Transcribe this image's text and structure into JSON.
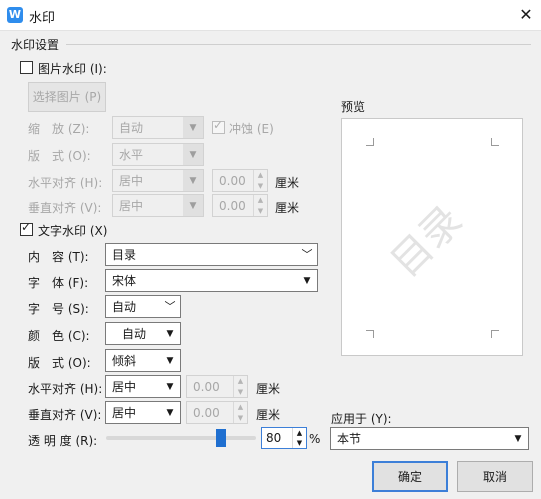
{
  "window": {
    "title": "水印",
    "app_icon": "W",
    "close": "✕"
  },
  "section_title": "水印设置",
  "picture_watermark": {
    "label": "图片水印 (I):",
    "checked": false,
    "select_button": "选择图片 (P)",
    "scale_label": "缩　放 (Z):",
    "scale_value": "自动",
    "washout_label": "冲蚀 (E)",
    "washout_checked": true,
    "layout_label": "版　式 (O):",
    "layout_value": "水平",
    "h_align_label": "水平对齐 (H):",
    "h_align_value": "居中",
    "h_offset_value": "0.00",
    "h_unit": "厘米",
    "v_align_label": "垂直对齐 (V):",
    "v_align_value": "居中",
    "v_offset_value": "0.00",
    "v_unit": "厘米"
  },
  "text_watermark": {
    "label": "文字水印 (X)",
    "checked": true,
    "content_label": "内　容 (T):",
    "content_value": "目录",
    "font_label": "字　体 (F):",
    "font_value": "宋体",
    "size_label": "字　号 (S):",
    "size_value": "自动",
    "color_label": "颜　色 (C):",
    "color_value": "自动",
    "layout_label": "版　式 (O):",
    "layout_value": "倾斜",
    "h_align_label": "水平对齐 (H):",
    "h_align_value": "居中",
    "h_offset_value": "0.00",
    "h_unit": "厘米",
    "v_align_label": "垂直对齐 (V):",
    "v_align_value": "居中",
    "v_offset_value": "0.00",
    "v_unit": "厘米",
    "transparency_label": "透 明 度 (R):",
    "transparency_value": "80",
    "transparency_unit": "%",
    "transparency_fraction": 0.8
  },
  "preview": {
    "label": "预览",
    "watermark_text": "目录"
  },
  "apply_to": {
    "label": "应用于 (Y):",
    "value": "本节"
  },
  "buttons": {
    "ok": "确定",
    "cancel": "取消"
  },
  "colors": {
    "accent": "#1f6fd0",
    "icon": "#2f8ded",
    "focus_border": "#3c7fd8"
  }
}
